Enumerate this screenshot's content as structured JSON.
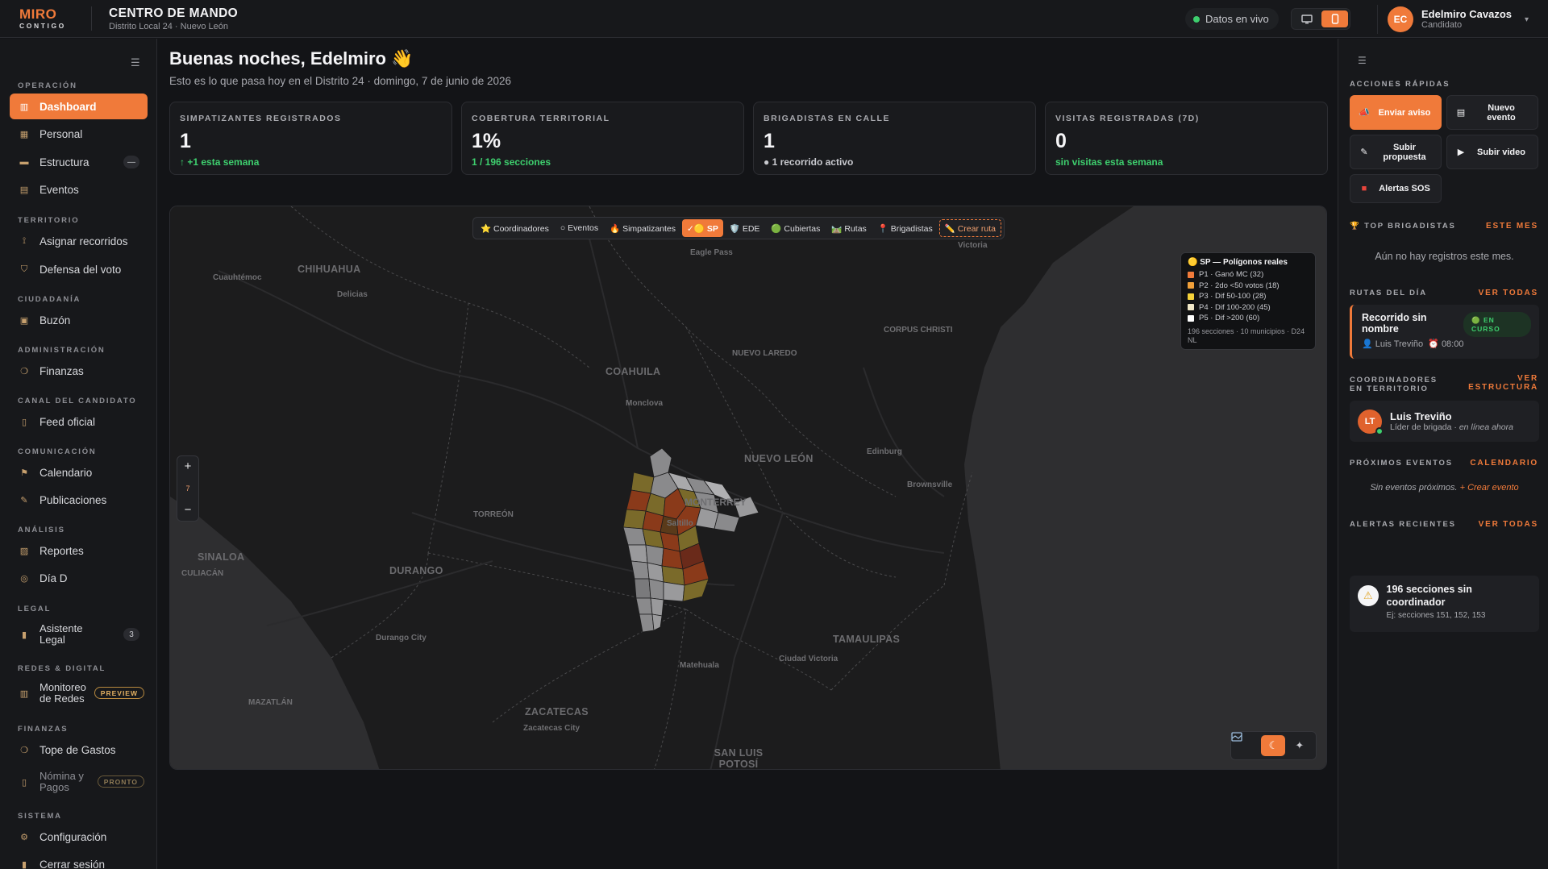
{
  "brand": {
    "name": "MIRO",
    "tagline": "CONTIGO"
  },
  "header": {
    "title": "CENTRO DE MANDO",
    "subtitle": "Distrito Local 24 · Nuevo León",
    "live_label": "Datos en vivo",
    "view_toggle": [
      "desktop-icon",
      "mobile-icon"
    ],
    "user": {
      "initials": "EC",
      "name": "Edelmiro Cavazos",
      "role": "Candidato"
    }
  },
  "sidebar": {
    "sections": [
      {
        "title": "OPERACIÓN",
        "items": [
          {
            "label": "Dashboard",
            "icon": "chart-icon",
            "active": true
          },
          {
            "label": "Personal",
            "icon": "people-icon"
          },
          {
            "label": "Estructura",
            "icon": "structure-icon",
            "badge": "—"
          },
          {
            "label": "Eventos",
            "icon": "calendar-icon"
          }
        ]
      },
      {
        "title": "TERRITORIO",
        "items": [
          {
            "label": "Asignar recorridos",
            "icon": "walk-icon"
          },
          {
            "label": "Defensa del voto",
            "icon": "shield-icon"
          }
        ]
      },
      {
        "title": "CIUDADANÍA",
        "items": [
          {
            "label": "Buzón",
            "icon": "inbox-icon"
          }
        ]
      },
      {
        "title": "ADMINISTRACIÓN",
        "items": [
          {
            "label": "Finanzas",
            "icon": "money-bag-icon"
          }
        ]
      },
      {
        "title": "CANAL DEL CANDIDATO",
        "items": [
          {
            "label": "Feed oficial",
            "icon": "feed-icon"
          }
        ]
      },
      {
        "title": "COMUNICACIÓN",
        "items": [
          {
            "label": "Calendario",
            "icon": "flag-icon"
          },
          {
            "label": "Publicaciones",
            "icon": "memo-icon"
          }
        ]
      },
      {
        "title": "ANÁLISIS",
        "items": [
          {
            "label": "Reportes",
            "icon": "report-icon"
          },
          {
            "label": "Día D",
            "icon": "target-icon"
          }
        ]
      },
      {
        "title": "LEGAL",
        "items": [
          {
            "label": "Asistente Legal",
            "icon": "book-icon",
            "badge": "3"
          }
        ]
      },
      {
        "title": "REDES & DIGITAL",
        "items": [
          {
            "label": "Monitoreo de Redes",
            "icon": "bar-chart-icon",
            "pill": "PREVIEW"
          }
        ]
      },
      {
        "title": "FINANZAS",
        "items": [
          {
            "label": "Tope de Gastos",
            "icon": "money-bag-icon"
          },
          {
            "label": "Nómina y Pagos",
            "icon": "payroll-icon",
            "pill": "PRONTO"
          }
        ]
      },
      {
        "title": "SISTEMA",
        "items": [
          {
            "label": "Configuración",
            "icon": "gear-icon"
          },
          {
            "label": "Cerrar sesión",
            "icon": "door-icon"
          }
        ]
      }
    ]
  },
  "main": {
    "greeting": "Buenas noches, Edelmiro 👋",
    "subheading": "Esto es lo que pasa hoy en el Distrito 24 · domingo, 7 de junio de 2026",
    "kpis": [
      {
        "label": "SIMPATIZANTES REGISTRADOS",
        "value": "1",
        "delta": "↑ +1 esta semana",
        "tone": "green"
      },
      {
        "label": "COBERTURA TERRITORIAL",
        "value": "1%",
        "delta": "1 / 196 secciones",
        "tone": "green"
      },
      {
        "label": "BRIGADISTAS EN CALLE",
        "value": "1",
        "delta": "● 1 recorrido activo",
        "tone": "grey"
      },
      {
        "label": "VISITAS REGISTRADAS (7D)",
        "value": "0",
        "delta": "sin visitas esta semana",
        "tone": "green"
      }
    ]
  },
  "map": {
    "filters": [
      {
        "label": "⭐ Coordinadores"
      },
      {
        "label": "○ Eventos"
      },
      {
        "label": "🔥 Simpatizantes"
      },
      {
        "label": "✓🟡 SP",
        "active": true
      },
      {
        "label": "🛡️ EDE"
      },
      {
        "label": "🟢 Cubiertas"
      },
      {
        "label": "🛤️ Rutas"
      },
      {
        "label": "📍 Brigadistas"
      },
      {
        "label": "✏️ Crear ruta",
        "dashed": true
      }
    ],
    "regions": [
      "CHIHUAHUA",
      "COAHUILA",
      "NUEVO LEÓN",
      "SINALOA",
      "DURANGO",
      "ZACATECAS",
      "TAMAULIPAS",
      "SAN LUIS POTOSÍ"
    ],
    "cities": [
      "Eagle Pass",
      "Victoria",
      "Cuauhtémoc",
      "Delicias",
      "NUEVO LAREDO",
      "CORPUS CHRISTI",
      "Monclova",
      "Edinburg",
      "Brownsville",
      "MONTERREY",
      "Saltillo",
      "TORREÓN",
      "CULIACÁN",
      "Durango City",
      "Matehuala",
      "Ciudad Victoria",
      "MAZATLÁN",
      "Zacatecas City"
    ],
    "legend": {
      "title": "🟡 SP — Polígonos reales",
      "items": [
        {
          "label": "P1 · Ganó MC (32)",
          "color": "#f07a3a"
        },
        {
          "label": "P2 · 2do <50 votos (18)",
          "color": "#f0a03a"
        },
        {
          "label": "P3 · Dif 50-100 (28)",
          "color": "#f5d23a"
        },
        {
          "label": "P4 · Dif 100-200 (45)",
          "color": "#f1e8c8"
        },
        {
          "label": "P5 · Dif >200 (60)",
          "color": "#ffffff"
        }
      ],
      "footer": "196 secciones · 10 municipios · D24 NL"
    },
    "zoom_level": "7",
    "basemap": [
      "map-icon",
      "moon-icon",
      "satellite-icon"
    ]
  },
  "right": {
    "quick_actions_title": "ACCIONES RÁPIDAS",
    "quick_actions": [
      {
        "label": "Enviar aviso",
        "icon": "megaphone-icon",
        "primary": true
      },
      {
        "label": "Nuevo evento",
        "icon": "calendar-icon"
      },
      {
        "label": "Subir propuesta",
        "icon": "memo-icon"
      },
      {
        "label": "Subir video",
        "icon": "camera-icon"
      },
      {
        "label": "Alertas SOS",
        "icon": "sos-icon"
      }
    ],
    "top_brigadistas": {
      "title": "🏆 TOP BRIGADISTAS",
      "link": "ESTE MES",
      "empty": "Aún no hay registros este mes."
    },
    "routes": {
      "title": "RUTAS DEL DÍA",
      "link": "VER TODAS",
      "card": {
        "name": "Recorrido sin nombre",
        "status": "🟢 EN CURSO",
        "person": "👤 Luis Treviño",
        "time": "⏰ 08:00"
      }
    },
    "coordinators": {
      "title": "COORDINADORES EN TERRITORIO",
      "link": "VER ESTRUCTURA",
      "card": {
        "initials": "LT",
        "name": "Luis Treviño",
        "role": "Líder de brigada · ",
        "presence": "en línea ahora"
      }
    },
    "events": {
      "title": "PRÓXIMOS EVENTOS",
      "link": "CALENDARIO",
      "empty": "Sin eventos próximos.",
      "create": "+ Crear evento"
    },
    "alerts": {
      "title": "ALERTAS RECIENTES",
      "link": "VER TODAS",
      "card": {
        "title": "196 secciones sin coordinador",
        "detail": "Ej: secciones 151, 152, 153"
      }
    }
  }
}
